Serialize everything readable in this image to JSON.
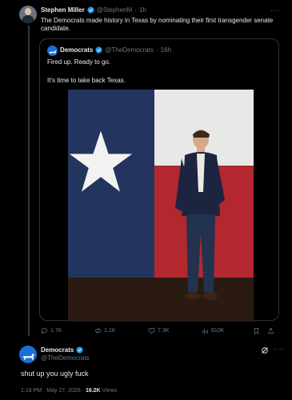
{
  "tweet": {
    "author_name": "Stephen Miller",
    "author_handle": "@StephenM",
    "separator": "·",
    "time": "1h",
    "text": "The Democrats made history in Texas by nominating their first transgender senate candidate.",
    "menu_glyph": "···"
  },
  "quote": {
    "author_name": "Democrats",
    "author_handle": "@TheDemocrats",
    "separator": "·",
    "time": "16h",
    "line1": "Fired up. Ready to go.",
    "line2": "It's time to take back Texas."
  },
  "stats": {
    "replies": "1.7K",
    "reposts": "1.1K",
    "likes": "7.3K",
    "views": "610K"
  },
  "reply": {
    "author_name": "Democrats",
    "author_handle": "@TheDemocrats",
    "text": "shut up you ugly fuck",
    "timestamp": "1:18 PM · May 27, 2026 · ",
    "views_count": "16.2K",
    "views_label": " Views",
    "menu_glyph": "···"
  },
  "colors": {
    "background": "#000000",
    "verified_blue": "#1d9bf0",
    "muted_text": "#71767b",
    "democrat_blue": "#1d6fd8"
  }
}
